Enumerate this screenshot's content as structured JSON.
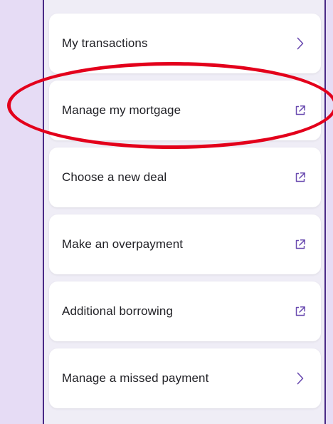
{
  "menu": {
    "items": [
      {
        "label": "My transactions",
        "icon": "chevron-right-icon"
      },
      {
        "label": "Manage my mortgage",
        "icon": "external-link-icon"
      },
      {
        "label": "Choose a new deal",
        "icon": "external-link-icon"
      },
      {
        "label": "Make an overpayment",
        "icon": "external-link-icon"
      },
      {
        "label": "Additional borrowing",
        "icon": "external-link-icon"
      },
      {
        "label": "Manage a missed payment",
        "icon": "chevron-right-icon"
      }
    ]
  },
  "colors": {
    "background": "#e6dcf5",
    "panel": "#efedf6",
    "accent": "#6a4bb0",
    "highlight": "#e3001b"
  }
}
